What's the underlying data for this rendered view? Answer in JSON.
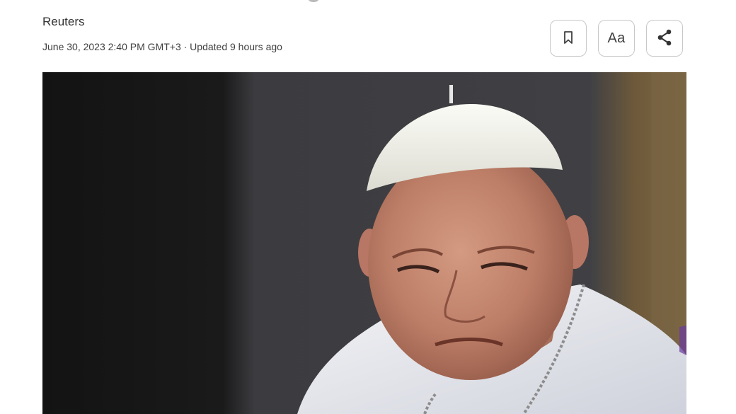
{
  "article": {
    "author": "Reuters",
    "timestamp": "June 30, 2023 2:40 PM GMT+3 · Updated 9 hours ago"
  },
  "toolbar": {
    "bookmark_icon": "bookmark-icon",
    "text_size_label": "Aa",
    "share_icon": "share-icon"
  },
  "colors": {
    "button_border": "#c8c8c8",
    "text_primary": "#333333",
    "photo_background": "#3a3a3d"
  }
}
